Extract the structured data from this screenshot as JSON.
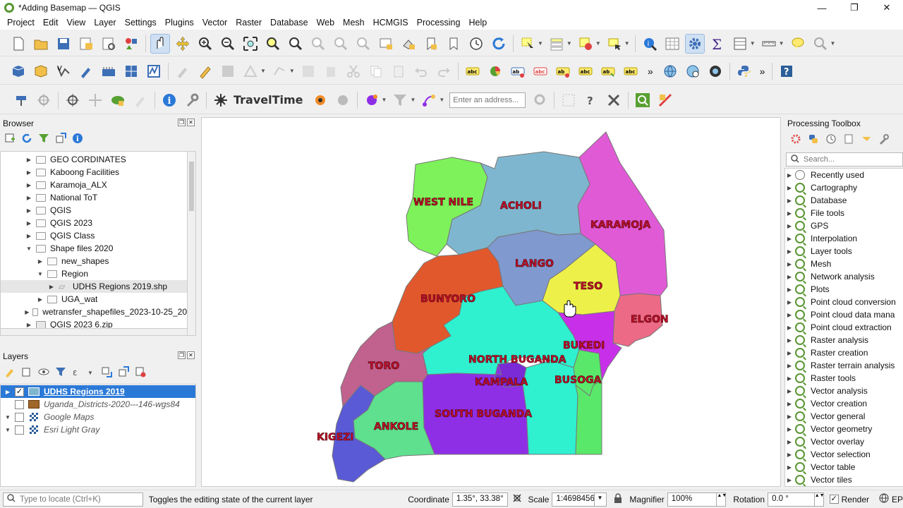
{
  "window": {
    "title": "*Adding Basemap — QGIS",
    "min": "—",
    "max": "❐",
    "close": "✕"
  },
  "menu": [
    "Project",
    "Edit",
    "View",
    "Layer",
    "Settings",
    "Plugins",
    "Vector",
    "Raster",
    "Database",
    "Web",
    "Mesh",
    "HCMGIS",
    "Processing",
    "Help"
  ],
  "toolbar3": {
    "travel_label": "TravelTime",
    "address_placeholder": "Enter an address..."
  },
  "browser": {
    "title": "Browser",
    "items": [
      {
        "label": "GEO CORDINATES",
        "indent": 0,
        "arrow": "▶"
      },
      {
        "label": "Kaboong Facilities",
        "indent": 0,
        "arrow": "▶"
      },
      {
        "label": "Karamoja_ALX",
        "indent": 0,
        "arrow": "▶"
      },
      {
        "label": "National ToT",
        "indent": 0,
        "arrow": "▶"
      },
      {
        "label": "QGIS",
        "indent": 0,
        "arrow": "▶"
      },
      {
        "label": "QGIS 2023",
        "indent": 0,
        "arrow": "▶"
      },
      {
        "label": "QGIS Class",
        "indent": 0,
        "arrow": "▶"
      },
      {
        "label": "Shape files 2020",
        "indent": 0,
        "arrow": "▼"
      },
      {
        "label": "new_shapes",
        "indent": 1,
        "arrow": "▶"
      },
      {
        "label": "Region",
        "indent": 1,
        "arrow": "▼"
      },
      {
        "label": "UDHS Regions 2019.shp",
        "indent": 2,
        "arrow": "▶",
        "selected": true
      },
      {
        "label": "UGA_wat",
        "indent": 1,
        "arrow": "▶"
      },
      {
        "label": "wetransfer_shapefiles_2023-10-25_20",
        "indent": 0,
        "arrow": "▶"
      },
      {
        "label": "QGIS 2023 6.zip",
        "indent": 0,
        "arrow": "▶"
      }
    ]
  },
  "layers": {
    "title": "Layers",
    "items": [
      {
        "label": "UDHS Regions 2019",
        "checked": true,
        "selected": true
      },
      {
        "label": "Uganda_Districts-2020---146-wgs84",
        "checked": false
      },
      {
        "label": "Google Maps",
        "checked": false
      },
      {
        "label": "Esri Light Gray",
        "checked": false
      }
    ]
  },
  "processing": {
    "title": "Processing Toolbox",
    "search_placeholder": "Search...",
    "items": [
      "Recently used",
      "Cartography",
      "Database",
      "File tools",
      "GPS",
      "Interpolation",
      "Layer tools",
      "Mesh",
      "Network analysis",
      "Plots",
      "Point cloud conversion",
      "Point cloud data mana",
      "Point cloud extraction",
      "Raster analysis",
      "Raster creation",
      "Raster terrain analysis",
      "Raster tools",
      "Vector analysis",
      "Vector creation",
      "Vector general",
      "Vector geometry",
      "Vector overlay",
      "Vector selection",
      "Vector table",
      "Vector tiles"
    ]
  },
  "map": {
    "regions": [
      {
        "name": "WEST NILE",
        "color": "#7ef25a"
      },
      {
        "name": "ACHOLI",
        "color": "#7fb6cf"
      },
      {
        "name": "KARAMOJA",
        "color": "#e05ad6"
      },
      {
        "name": "LANGO",
        "color": "#8099cf"
      },
      {
        "name": "TESO",
        "color": "#eef04a"
      },
      {
        "name": "ELGON",
        "color": "#ec6a86"
      },
      {
        "name": "BUNYORO",
        "color": "#e2582d"
      },
      {
        "name": "BUKEDI",
        "color": "#c730e8"
      },
      {
        "name": "NORTH BUGANDA",
        "color": "#2ff0cf"
      },
      {
        "name": "KAMPALA",
        "color": "#7a2bd6"
      },
      {
        "name": "BUSOGA",
        "color": "#5ae86a"
      },
      {
        "name": "TORO",
        "color": "#c0618e"
      },
      {
        "name": "SOUTH BUGANDA",
        "color": "#8e2fe6"
      },
      {
        "name": "ANKOLE",
        "color": "#5ee08e"
      },
      {
        "name": "KIGEZI",
        "color": "#5a5ad6"
      }
    ]
  },
  "status": {
    "locate_placeholder": "Type to locate (Ctrl+K)",
    "message": "Toggles the editing state of the current layer",
    "coordinate_label": "Coordinate",
    "coordinate_value": "1.35°, 33.38°",
    "scale_label": "Scale",
    "scale_value": "1:4698456",
    "magnifier_label": "Magnifier",
    "magnifier_value": "100%",
    "rotation_label": "Rotation",
    "rotation_value": "0.0 °",
    "render_label": "Render",
    "crs_label": "EP"
  }
}
